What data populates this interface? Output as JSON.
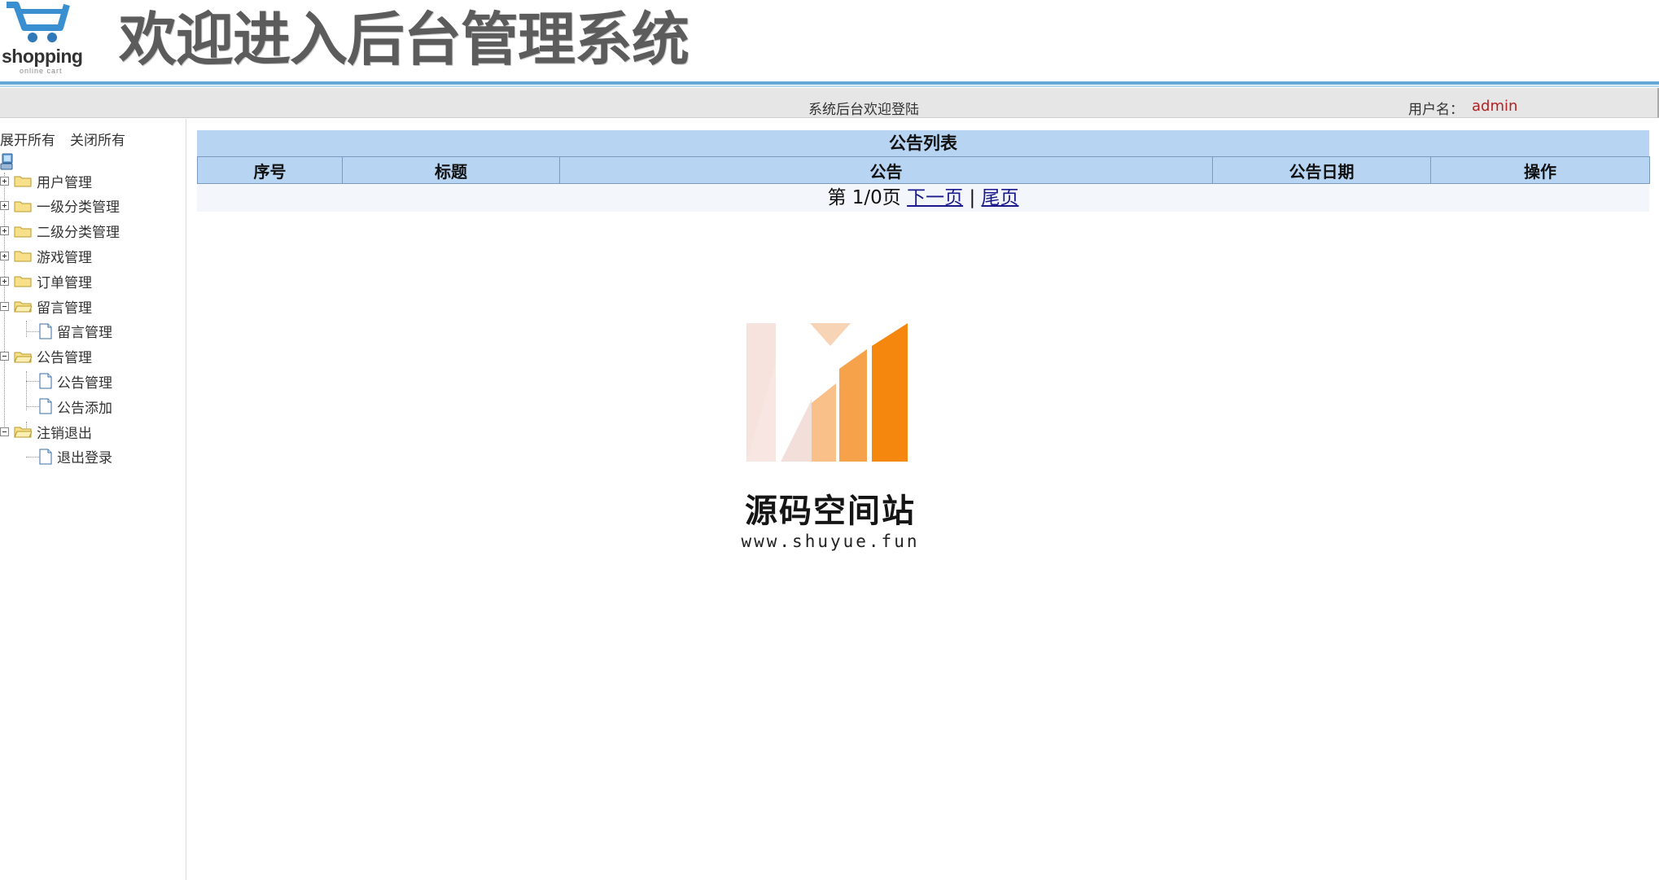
{
  "header": {
    "logo_text": "shopping",
    "logo_sub": "online cart",
    "title": "欢迎进入后台管理系统"
  },
  "statusbar": {
    "welcome": "系统后台欢迎登陆",
    "user_label": "用户名：",
    "user_name": "admin"
  },
  "sidebar": {
    "expand_all": "展开所有",
    "collapse_all": "关闭所有",
    "nodes": [
      {
        "label": "用户管理",
        "expanded": false,
        "children": []
      },
      {
        "label": "一级分类管理",
        "expanded": false,
        "children": []
      },
      {
        "label": "二级分类管理",
        "expanded": false,
        "children": []
      },
      {
        "label": "游戏管理",
        "expanded": false,
        "children": []
      },
      {
        "label": "订单管理",
        "expanded": false,
        "children": []
      },
      {
        "label": "留言管理",
        "expanded": true,
        "children": [
          "留言管理"
        ]
      },
      {
        "label": "公告管理",
        "expanded": true,
        "children": [
          "公告管理",
          "公告添加"
        ]
      },
      {
        "label": "注销退出",
        "expanded": true,
        "children": [
          "退出登录"
        ]
      }
    ]
  },
  "main": {
    "caption": "公告列表",
    "columns": [
      "序号",
      "标题",
      "公告",
      "公告日期",
      "操作"
    ],
    "pager": {
      "prefix": "第 1/0页",
      "next": "下一页",
      "separator": "|",
      "last": "尾页"
    }
  },
  "watermark": {
    "title": "源码空间站",
    "url": "www.shuyue.fun"
  },
  "colors": {
    "header_rule": "#64a8d8",
    "table_header": "#b7d4f2",
    "user_name": "#b22222",
    "watermark_orange": "#f5870e"
  }
}
